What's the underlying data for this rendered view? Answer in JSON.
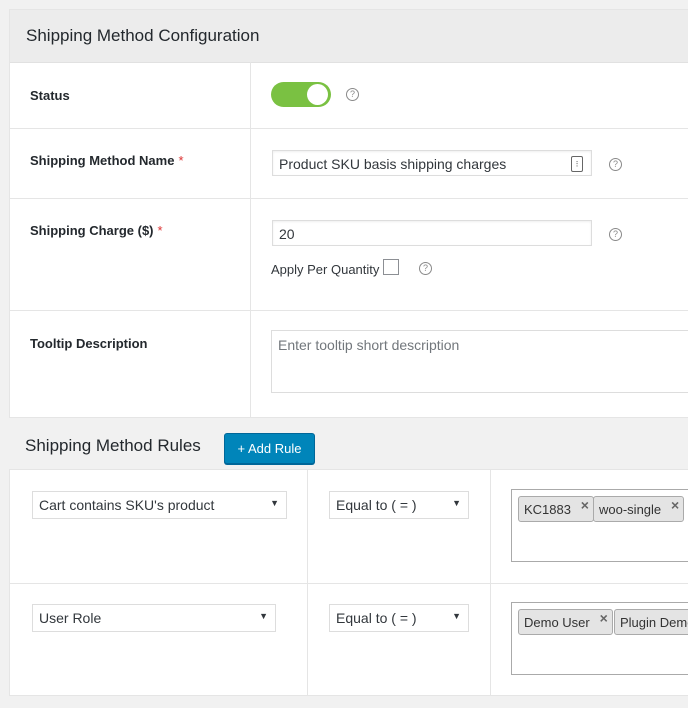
{
  "config": {
    "title": "Shipping Method Configuration",
    "status": {
      "label": "Status",
      "enabled": true,
      "help": "?"
    },
    "method_name": {
      "label": "Shipping Method Name",
      "required_mark": "*",
      "value": "Product SKU basis shipping charges",
      "help": "?"
    },
    "charge": {
      "label": "Shipping Charge ($)",
      "required_mark": "*",
      "value": "20",
      "help": "?",
      "per_quantity_label": "Apply Per Quantity",
      "per_quantity_checked": false,
      "per_quantity_help": "?"
    },
    "tooltip": {
      "label": "Tooltip Description",
      "placeholder": "Enter tooltip short description"
    }
  },
  "rules": {
    "title": "Shipping Method Rules",
    "add_button": "+ Add Rule",
    "rows": [
      {
        "condition": "Cart contains SKU's product",
        "operator": "Equal to ( = )",
        "values": [
          "KC1883",
          "woo-single"
        ]
      },
      {
        "condition": "User Role",
        "operator": "Equal to ( = )",
        "values": [
          "Demo User",
          "Plugin Demo"
        ]
      }
    ],
    "tag_remove": "×",
    "arrow": "▼"
  },
  "colors": {
    "toggle_on": "#7ac142",
    "button": "#0085ba",
    "required": "#dc3232"
  }
}
